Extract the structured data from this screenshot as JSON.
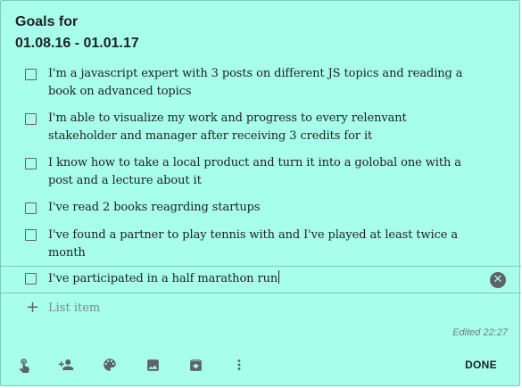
{
  "note": {
    "title_line1": "Goals for",
    "title_line2": "01.08.16 - 01.01.17",
    "background": "#a7ffeb"
  },
  "items": [
    {
      "text": " I'm  a javascript expert with 3 posts on different JS topics and reading a book on advanced topics",
      "checked": false
    },
    {
      "text": "I'm able to visualize my work and progress to every relenvant stakeholder and manager after receiving 3 credits for it",
      "checked": false
    },
    {
      "text": "I know how to take a local product and turn it into a golobal one with a post and a lecture about it",
      "checked": false
    },
    {
      "text": "I've read 2 books reagrding startups",
      "checked": false
    },
    {
      "text": "I've found a partner to play tennis with and I've played at least twice a month",
      "checked": false
    },
    {
      "text": "I've participated in a half marathon run",
      "checked": false
    }
  ],
  "add_item": {
    "icon": "plus-icon",
    "placeholder": "List item"
  },
  "edited": "Edited 22:27",
  "toolbar": {
    "icons": [
      "reminder-icon",
      "collaborator-icon",
      "palette-icon",
      "image-icon",
      "archive-icon",
      "more-icon"
    ],
    "done_label": "DONE"
  }
}
